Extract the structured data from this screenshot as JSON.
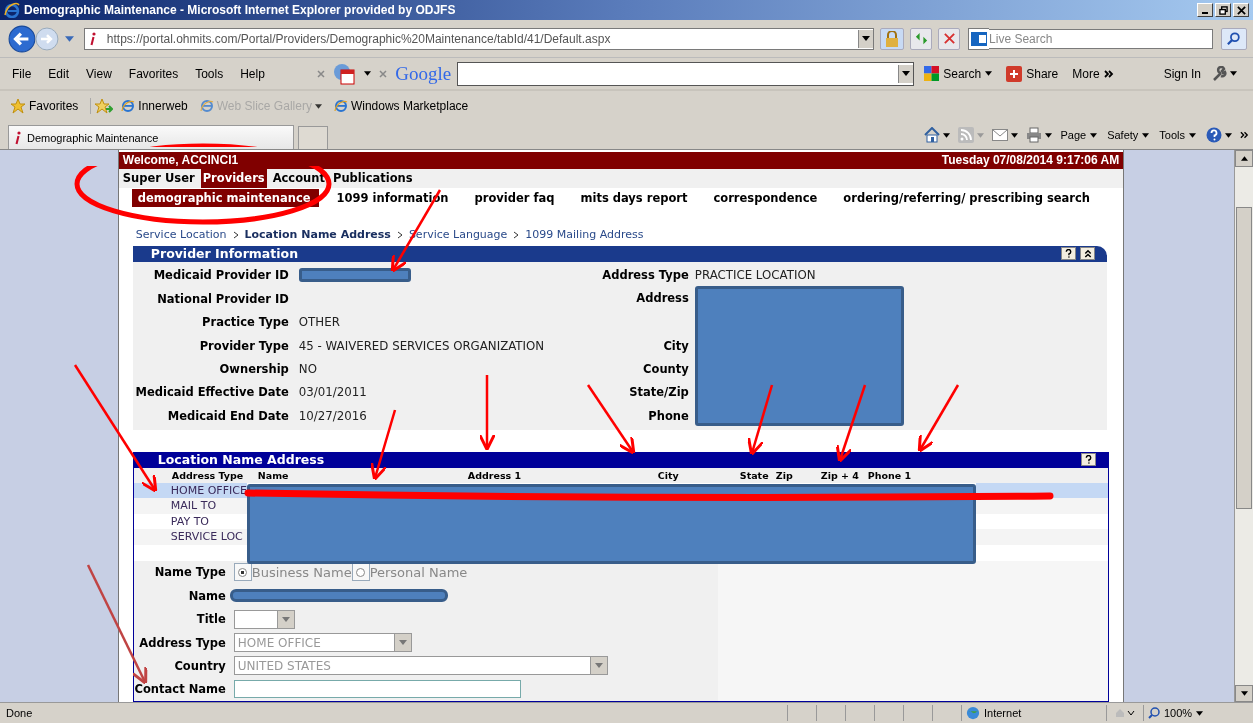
{
  "window": {
    "title": "Demographic Maintenance - Microsoft Internet Explorer provided by ODJFS"
  },
  "address_bar": {
    "url": "https://portal.ohmits.com/Portal/Providers/Demographic%20Maintenance/tabId/41/Default.aspx"
  },
  "live_search": {
    "placeholder": "Live Search"
  },
  "menu": [
    "File",
    "Edit",
    "View",
    "Favorites",
    "Tools",
    "Help"
  ],
  "google_toolbar": {
    "logo": "Google",
    "search": "Search",
    "share": "Share",
    "more": "More",
    "sign_in": "Sign In"
  },
  "favorites_bar": {
    "label": "Favorites",
    "links": [
      {
        "label": "Innerweb",
        "disabled": false
      },
      {
        "label": "Web Slice Gallery",
        "disabled": true
      },
      {
        "label": "Windows Marketplace",
        "disabled": false
      }
    ]
  },
  "tab": {
    "title": "Demographic Maintenance"
  },
  "command_bar": [
    "Page",
    "Safety",
    "Tools"
  ],
  "page": {
    "welcome": "Welcome, ACCINCI1",
    "datetime": "Tuesday 07/08/2014 9:17:06 AM",
    "nav_tabs": [
      {
        "label": "Super User",
        "selected": false
      },
      {
        "label": "Providers",
        "selected": true
      },
      {
        "label": "Account",
        "selected": false
      },
      {
        "label": "Publications",
        "selected": false
      }
    ],
    "sub_nav": [
      {
        "label": "demographic maintenance",
        "selected": true
      },
      {
        "label": "1099 information",
        "selected": false
      },
      {
        "label": "provider faq",
        "selected": false
      },
      {
        "label": "mits days report",
        "selected": false
      },
      {
        "label": "correspondence",
        "selected": false
      },
      {
        "label": "ordering/referring/ prescribing search",
        "selected": false
      }
    ],
    "breadcrumb": [
      {
        "label": "Service Location",
        "selected": false
      },
      {
        "label": "Location Name Address",
        "selected": true
      },
      {
        "label": "Service Language",
        "selected": false
      },
      {
        "label": "1099 Mailing Address",
        "selected": false
      }
    ],
    "provider_info": {
      "title": "Provider Information",
      "left_fields": [
        {
          "label": "Medicaid Provider ID",
          "redacted": true
        },
        {
          "label": "National Provider ID"
        },
        {
          "label": "Practice Type",
          "value": "OTHER"
        },
        {
          "label": "Provider Type",
          "value": "45 - WAIVERED SERVICES ORGANIZATION"
        },
        {
          "label": "Ownership",
          "value": "NO"
        },
        {
          "label": "Medicaid Effective Date",
          "value": "03/01/2011"
        },
        {
          "label": "Medicaid End Date",
          "value": "10/27/2016"
        }
      ],
      "address_type": {
        "label": "Address Type",
        "value": "PRACTICE LOCATION"
      },
      "right_labels": [
        "Address",
        "City",
        "County",
        "State/Zip",
        "Phone"
      ]
    },
    "location": {
      "title": "Location Name Address",
      "columns": [
        "Address Type",
        "Name",
        "Address 1",
        "City",
        "State",
        "Zip",
        "Zip + 4",
        "Phone 1"
      ],
      "rows": [
        {
          "address_type": "HOME OFFICE",
          "selected": true
        },
        {
          "address_type": "MAIL TO",
          "selected": false
        },
        {
          "address_type": "PAY TO",
          "selected": false
        },
        {
          "address_type": "SERVICE LOC",
          "selected": false
        }
      ]
    },
    "form": {
      "name_type_label": "Name Type",
      "name_types": [
        {
          "label": "Business Name",
          "selected": true
        },
        {
          "label": "Personal Name",
          "selected": false
        }
      ],
      "name_label": "Name",
      "title_label": "Title",
      "address_type": {
        "label": "Address Type",
        "value": "HOME OFFICE",
        "disabled": true
      },
      "country": {
        "label": "Country",
        "value": "UNITED STATES",
        "disabled": true
      },
      "contact_label": "Contact Name"
    }
  },
  "status_bar": {
    "text": "Done",
    "zone": "Internet",
    "zoom": "100%"
  }
}
